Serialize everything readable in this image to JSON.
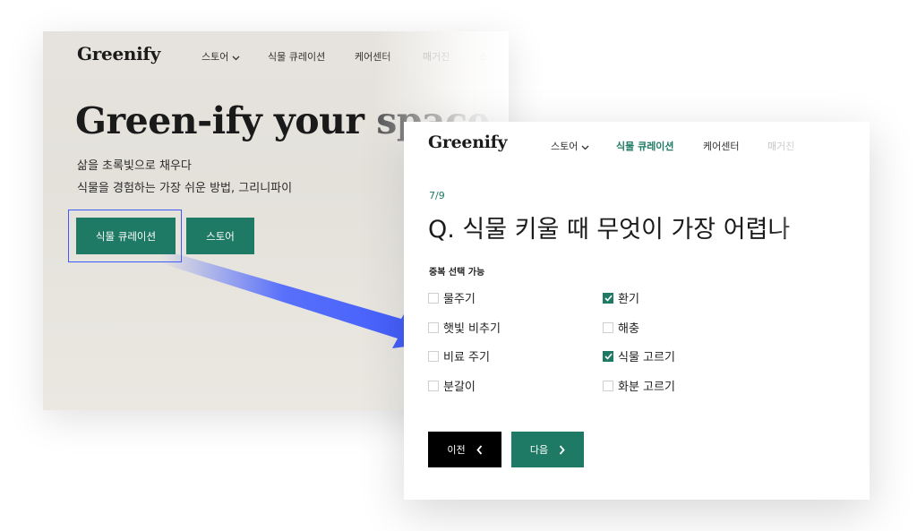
{
  "back": {
    "logo": "Greenify",
    "nav": [
      {
        "label": "스토어",
        "muted": false
      },
      {
        "label": "식물 큐레이션",
        "muted": false
      },
      {
        "label": "케어센터",
        "muted": false
      },
      {
        "label": "매거진",
        "muted": true
      },
      {
        "label": "소",
        "muted": true
      }
    ],
    "hero": {
      "title": "Green-ify your ",
      "title_dim": "space"
    },
    "subtitle_1": "삶을 초록빛으로 채우다",
    "subtitle_2": "식물을 경험하는 가장 쉬운 방법, 그리니파이",
    "buttons": {
      "curation": "식물 큐레이션",
      "store": "스토어"
    }
  },
  "front": {
    "logo": "Greenify",
    "nav": [
      {
        "label": "스토어"
      },
      {
        "label": "식물 큐레이션"
      },
      {
        "label": "케어센터"
      },
      {
        "label": "매거진"
      }
    ],
    "progress": "7/9",
    "question": "Q. 식물 키울 때 무엇이 가장 어렵나",
    "multi_select_label": "중복 선택 가능",
    "options": [
      {
        "label": "물주기",
        "checked": false
      },
      {
        "label": "환기",
        "checked": true
      },
      {
        "label": "햇빛 비추기",
        "checked": false
      },
      {
        "label": "해충",
        "checked": false
      },
      {
        "label": "비료 주기",
        "checked": false
      },
      {
        "label": "식물 고르기",
        "checked": true
      },
      {
        "label": "분갈이",
        "checked": false
      },
      {
        "label": "화분 고르기",
        "checked": false
      }
    ],
    "prev_label": "이전",
    "next_label": "다음"
  },
  "colors": {
    "accent": "#1e7a64",
    "arrow": "#3f5bff"
  }
}
